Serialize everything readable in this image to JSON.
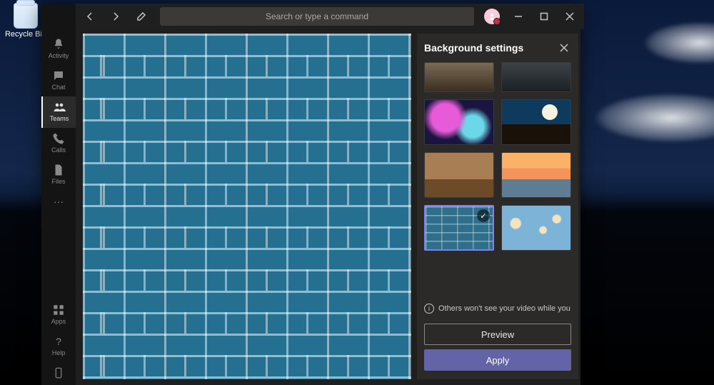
{
  "desktop": {
    "recycle_bin_label": "Recycle Bin"
  },
  "titlebar": {
    "search_placeholder": "Search or type a command"
  },
  "rail": {
    "items": [
      {
        "label": "Activity"
      },
      {
        "label": "Chat"
      },
      {
        "label": "Teams"
      },
      {
        "label": "Calls"
      },
      {
        "label": "Files"
      }
    ],
    "apps_label": "Apps",
    "help_label": "Help"
  },
  "panel": {
    "title": "Background settings",
    "info_text": "Others won't see your video while you previe...",
    "preview_label": "Preview",
    "apply_label": "Apply",
    "thumbs": [
      {
        "name": "bg-village-alley",
        "selected": false
      },
      {
        "name": "bg-mountain-dark",
        "selected": false
      },
      {
        "name": "bg-galaxy-nebula",
        "selected": false
      },
      {
        "name": "bg-moon-cliff",
        "selected": false
      },
      {
        "name": "bg-autumn-street",
        "selected": false
      },
      {
        "name": "bg-sunset-person",
        "selected": false
      },
      {
        "name": "bg-blue-brick-wall",
        "selected": true
      },
      {
        "name": "bg-toy-clouds",
        "selected": false
      }
    ]
  }
}
